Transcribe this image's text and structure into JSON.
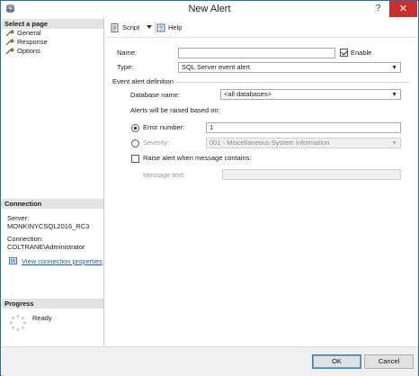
{
  "window": {
    "title": "New Alert",
    "help_glyph": "?",
    "close_glyph": "✕"
  },
  "left_panel": {
    "select_page_header": "Select a page",
    "pages": [
      {
        "label": "General"
      },
      {
        "label": "Response"
      },
      {
        "label": "Options"
      }
    ],
    "connection_header": "Connection",
    "server_label": "Server:",
    "server_value": "MONK\\NYCSQL2016_RC3",
    "connection_label": "Connection:",
    "connection_value": "COLTRANE\\Administrator",
    "view_connection_link": "View connection properties",
    "progress_header": "Progress",
    "progress_status": "Ready"
  },
  "toolbar": {
    "script_label": "Script",
    "help_label": "Help"
  },
  "form": {
    "name_label": "Name:",
    "name_value": "",
    "enable_label": "Enable",
    "enable_checked": true,
    "type_label": "Type:",
    "type_value": "SQL Server event alert",
    "event_group_label": "Event alert definition",
    "database_label": "Database name:",
    "database_value": "<all databases>",
    "raised_label": "Alerts will be raised based on:",
    "error_number_label": "Error number:",
    "error_number_value": "1",
    "error_number_selected": true,
    "severity_label": "Severity:",
    "severity_value": "001 - Miscellaneous System Information",
    "severity_selected": false,
    "raise_alert_label": "Raise alert when message contains:",
    "raise_alert_checked": false,
    "message_text_label": "Message text:",
    "message_text_value": ""
  },
  "footer": {
    "ok_label": "OK",
    "cancel_label": "Cancel"
  },
  "colors": {
    "window_border": "#1f6fb5",
    "close_button": "#c9302c",
    "link": "#1a5fb0",
    "section_header_bg": "#e3e3e3"
  }
}
